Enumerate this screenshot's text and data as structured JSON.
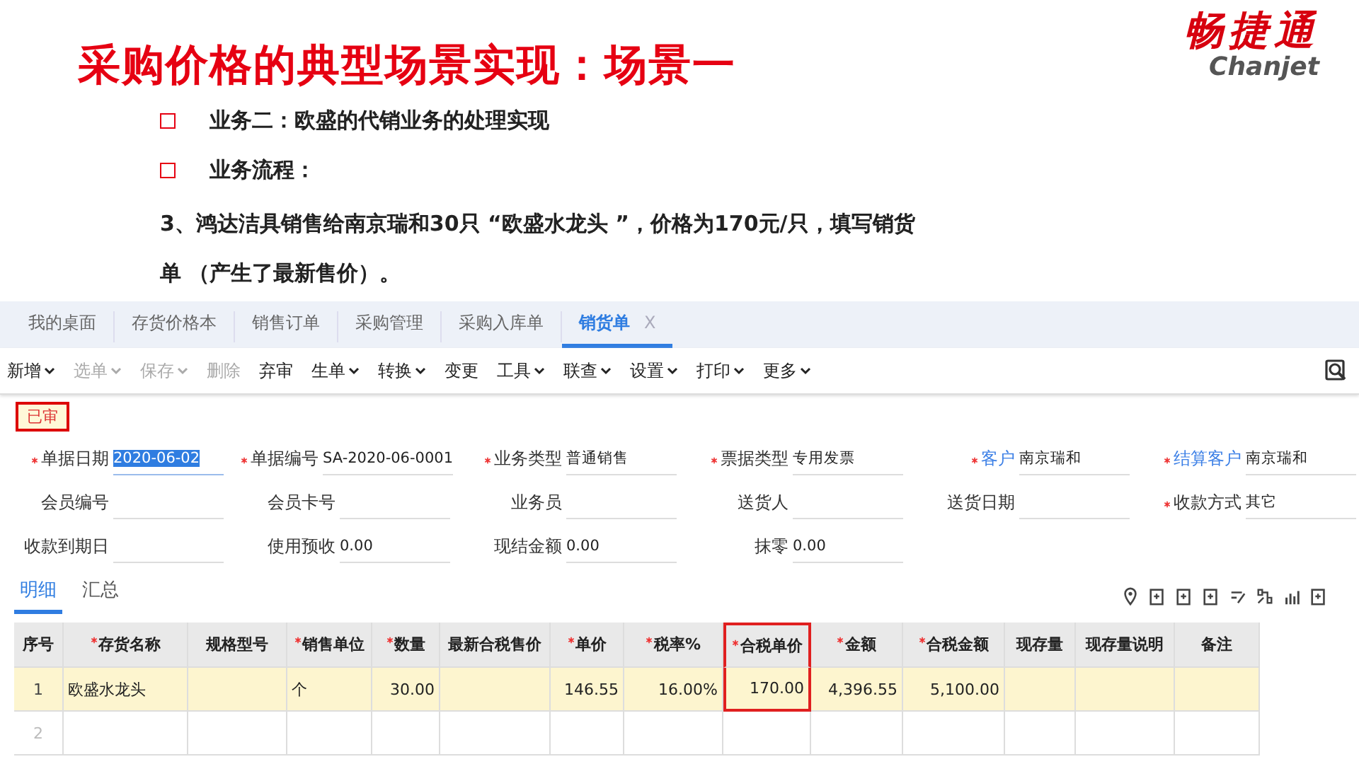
{
  "slide": {
    "title": "采购价格的典型场景实现：场景一",
    "logo": {
      "name": "畅捷通",
      "latin": "Chanjet"
    },
    "bullets": [
      "业务二：欧盛的代销业务的处理实现",
      "业务流程："
    ],
    "paragraph": "3、鸿达洁具销售给南京瑞和30只 “欧盛水龙头 ”，价格为170元/只，填写销货单 （产生了最新售价）。"
  },
  "tabs": [
    {
      "label": "我的桌面",
      "selected": false
    },
    {
      "label": "存货价格本",
      "selected": false
    },
    {
      "label": "销售订单",
      "selected": false
    },
    {
      "label": "采购管理",
      "selected": false
    },
    {
      "label": "采购入库单",
      "selected": false
    },
    {
      "label": "销货单",
      "selected": true,
      "close": "X"
    }
  ],
  "toolbar": [
    {
      "label": "新增",
      "dropdown": true,
      "disabled": false
    },
    {
      "label": "选单",
      "dropdown": true,
      "disabled": true
    },
    {
      "label": "保存",
      "dropdown": true,
      "disabled": true
    },
    {
      "label": "删除",
      "dropdown": false,
      "disabled": true
    },
    {
      "label": "弃审",
      "dropdown": false,
      "disabled": false
    },
    {
      "label": "生单",
      "dropdown": true,
      "disabled": false
    },
    {
      "label": "转换",
      "dropdown": true,
      "disabled": false
    },
    {
      "label": "变更",
      "dropdown": false,
      "disabled": false
    },
    {
      "label": "工具",
      "dropdown": true,
      "disabled": false
    },
    {
      "label": "联查",
      "dropdown": true,
      "disabled": false
    },
    {
      "label": "设置",
      "dropdown": true,
      "disabled": false
    },
    {
      "label": "打印",
      "dropdown": true,
      "disabled": false
    },
    {
      "label": "更多",
      "dropdown": true,
      "disabled": false
    }
  ],
  "status": "已审",
  "form": [
    {
      "label": "单据日期",
      "value": "2020-06-02",
      "required": true,
      "link": false,
      "highlighted": true
    },
    {
      "label": "单据编号",
      "value": "SA-2020-06-0001",
      "required": true,
      "link": false,
      "highlighted": false
    },
    {
      "label": "业务类型",
      "value": "普通销售",
      "required": true,
      "link": false,
      "highlighted": false
    },
    {
      "label": "票据类型",
      "value": "专用发票",
      "required": true,
      "link": false,
      "highlighted": false
    },
    {
      "label": "客户",
      "value": "南京瑞和",
      "required": true,
      "link": true,
      "highlighted": false
    },
    {
      "label": "结算客户",
      "value": "南京瑞和",
      "required": true,
      "link": true,
      "highlighted": false
    },
    {
      "label": "会员编号",
      "required": false,
      "link": false,
      "highlighted": false
    },
    {
      "label": "会员卡号",
      "required": false,
      "link": false,
      "highlighted": false
    },
    {
      "label": "业务员",
      "required": false,
      "link": false,
      "highlighted": false
    },
    {
      "label": "送货人",
      "required": false,
      "link": false,
      "highlighted": false
    },
    {
      "label": "送货日期",
      "required": false,
      "link": false,
      "highlighted": false
    },
    {
      "label": "收款方式",
      "value": "其它",
      "required": true,
      "link": false,
      "highlighted": false
    },
    {
      "label": "收款到期日",
      "required": false,
      "link": false,
      "highlighted": false
    },
    {
      "label": "使用预收",
      "value": "0.00",
      "required": false,
      "link": false,
      "highlighted": false
    },
    {
      "label": "现结金额",
      "value": "0.00",
      "required": false,
      "link": false,
      "highlighted": false
    },
    {
      "label": "抹零",
      "value": "0.00",
      "required": false,
      "link": false,
      "highlighted": false
    }
  ],
  "subtabs": [
    {
      "label": "明细",
      "selected": true
    },
    {
      "label": "汇总",
      "selected": false
    }
  ],
  "table": {
    "columns": [
      {
        "label": "序号",
        "required": false,
        "highlighted": false
      },
      {
        "label": "存货名称",
        "required": true,
        "highlighted": false
      },
      {
        "label": "规格型号",
        "required": false,
        "highlighted": false
      },
      {
        "label": "销售单位",
        "required": true,
        "highlighted": false
      },
      {
        "label": "数量",
        "required": true,
        "highlighted": false
      },
      {
        "label": "最新合税售价",
        "required": false,
        "highlighted": false
      },
      {
        "label": "单价",
        "required": true,
        "highlighted": false
      },
      {
        "label": "税率%",
        "required": true,
        "highlighted": false
      },
      {
        "label": "合税单价",
        "required": true,
        "highlighted": true
      },
      {
        "label": "金额",
        "required": true,
        "highlighted": false
      },
      {
        "label": "合税金额",
        "required": true,
        "highlighted": false
      },
      {
        "label": "现存量",
        "required": false,
        "highlighted": false
      },
      {
        "label": "现存量说明",
        "required": false,
        "highlighted": false
      },
      {
        "label": "备注",
        "required": false,
        "highlighted": false
      }
    ],
    "rows": [
      {
        "selected": true,
        "cells": [
          "1",
          "欧盛水龙头",
          "",
          "个",
          "30.00",
          "",
          "146.55",
          "16.00%",
          "170.00",
          "4,396.55",
          "5,100.00",
          "",
          "",
          ""
        ]
      },
      {
        "selected": false,
        "cells": [
          "2",
          "",
          "",
          "",
          "",
          "",
          "",
          "",
          "",
          "",
          "",
          "",
          "",
          ""
        ]
      }
    ]
  }
}
